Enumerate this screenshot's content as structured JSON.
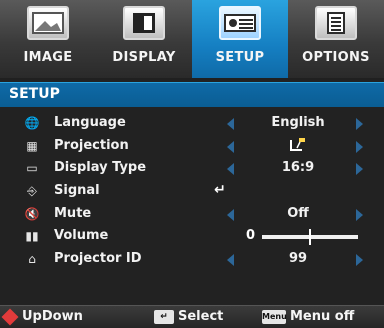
{
  "tabs": [
    {
      "label": "IMAGE",
      "icon": "image-icon",
      "active": false
    },
    {
      "label": "DISPLAY",
      "icon": "display-icon",
      "active": false
    },
    {
      "label": "SETUP",
      "icon": "setup-icon",
      "active": true
    },
    {
      "label": "OPTIONS",
      "icon": "options-icon",
      "active": false
    }
  ],
  "section": {
    "title": "SETUP"
  },
  "items": [
    {
      "icon": "language-icon",
      "label": "Language",
      "value": "English",
      "has_arrows": true
    },
    {
      "icon": "projection-icon",
      "label": "Projection",
      "value": "",
      "value_icon": "projection-mode-icon",
      "has_arrows": true
    },
    {
      "icon": "display-type-icon",
      "label": "Display Type",
      "value": "16:9",
      "has_arrows": true
    },
    {
      "icon": "signal-icon",
      "label": "Signal",
      "value": "",
      "enter_symbol": "↵",
      "has_arrows": false
    },
    {
      "icon": "mute-icon",
      "label": "Mute",
      "value": "Off",
      "has_arrows": true
    },
    {
      "icon": "volume-icon",
      "label": "Volume",
      "value": "0",
      "slider_level": 0.5,
      "has_arrows": false
    },
    {
      "icon": "projector-id-icon",
      "label": "Projector ID",
      "value": "99",
      "has_arrows": true
    }
  ],
  "footer": {
    "updown_label": "UpDown",
    "select_label": "Select",
    "menu_label": "Menu off",
    "menu_badge": "Menu"
  },
  "colors": {
    "accent": "#157fc2",
    "footer_red": "#e23b3b"
  }
}
